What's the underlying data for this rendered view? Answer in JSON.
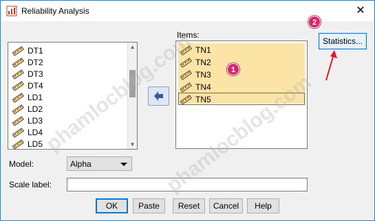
{
  "window": {
    "title": "Reliability Analysis",
    "close_glyph": "✕"
  },
  "source_list": {
    "items": [
      "DT1",
      "DT2",
      "DT3",
      "DT4",
      "LD1",
      "LD2",
      "LD3",
      "LD4",
      "LD5"
    ]
  },
  "target_list": {
    "label": "Items:",
    "items": [
      "TN1",
      "TN2",
      "TN3",
      "TN4",
      "TN5"
    ]
  },
  "buttons": {
    "statistics": "Statistics...",
    "ok": "OK",
    "paste": "Paste",
    "reset": "Reset",
    "cancel": "Cancel",
    "help": "Help"
  },
  "model": {
    "label": "Model:",
    "value": "Alpha"
  },
  "scale": {
    "label": "Scale label:",
    "value": ""
  },
  "annotations": {
    "badge1": "1",
    "badge2": "2",
    "accent": "#d4266b"
  },
  "watermark": {
    "text1": "phamlocblog.com",
    "text2": "phamlocblog.com"
  },
  "icons": {
    "variable": "ruler-icon",
    "move": "arrow-left-icon"
  }
}
